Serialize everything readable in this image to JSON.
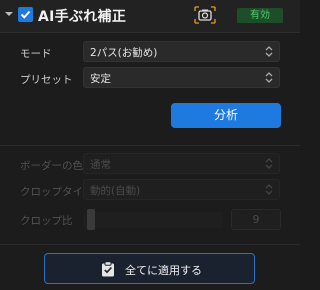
{
  "header": {
    "title": "AI手ぶれ補正",
    "checked": true,
    "status": "有効",
    "icons": [
      "chevron-down-icon",
      "check-icon",
      "camera-icon"
    ]
  },
  "settings": {
    "mode": {
      "label": "モード",
      "value": "2パス(お勧め)"
    },
    "preset": {
      "label": "プリセット",
      "value": "安定"
    },
    "analyze_label": "分析"
  },
  "disabled": {
    "border_color": {
      "label": "ボーダーの色",
      "value": "通常"
    },
    "crop_type": {
      "label": "クロップタイプ",
      "value": "動的(自動)"
    },
    "crop_ratio": {
      "label": "クロップ比",
      "value": "9"
    }
  },
  "footer": {
    "apply_label": "全てに適用する"
  },
  "colors": {
    "accent": "#1f7ae0",
    "status_bg": "#1e4d2a",
    "status_text": "#4ed06a"
  }
}
